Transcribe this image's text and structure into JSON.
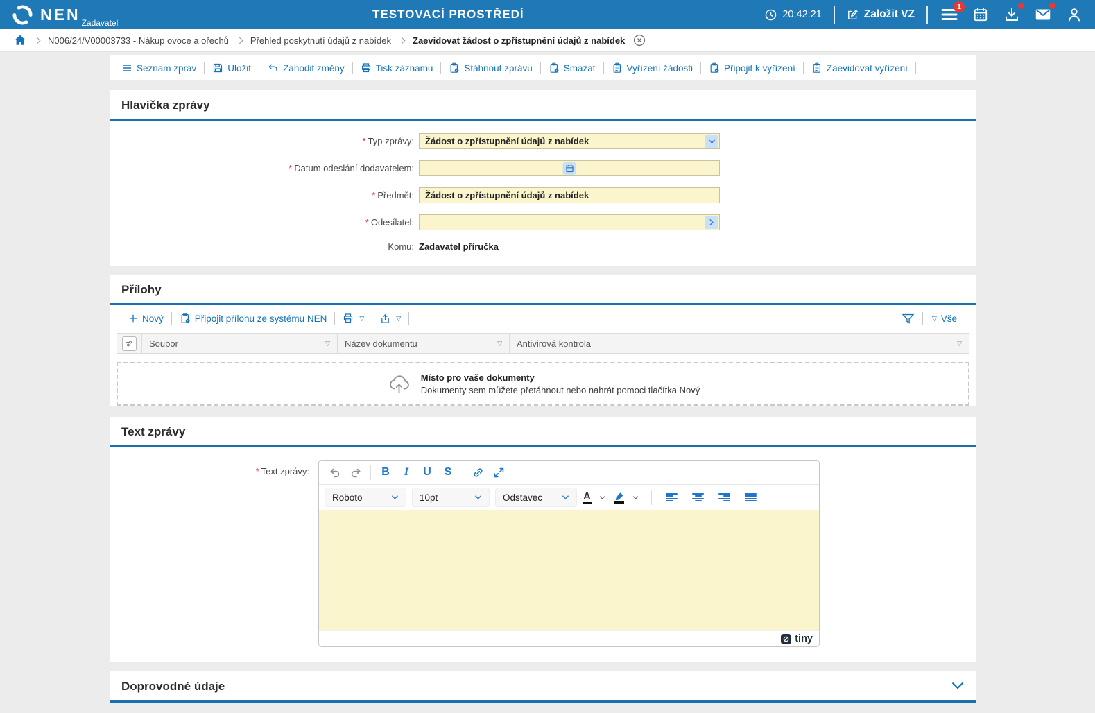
{
  "ui": {
    "required_marker": "*"
  },
  "colors": {
    "header_blue": "#1E79B6",
    "accent_blue": "#1474B8",
    "field_yellow": "#FBF5CD",
    "badge_red": "#E53935",
    "section_line_blue": "#1B6FAE",
    "editor_icon_blue": "#2276C9"
  },
  "header": {
    "logo": "NEN",
    "logo_sub": "Zadavatel",
    "env_title": "TESTOVACÍ PROSTŘEDÍ",
    "time": "20:42:21",
    "create_vz_label": "Založit VZ",
    "menu_badge": "1"
  },
  "breadcrumb": {
    "items": [
      "N006/24/V00003733 - Nákup ovoce a ořechů",
      "Přehled poskytnutí údajů z nabídek",
      "Zaevidovat žádost o zpřístupnění údajů z nabídek"
    ]
  },
  "toolbar": {
    "items": [
      {
        "label": "Seznam zpráv",
        "icon": "menu-icon"
      },
      {
        "label": "Uložit",
        "icon": "save-icon"
      },
      {
        "label": "Zahodit změny",
        "icon": "discard-icon"
      },
      {
        "label": "Tisk záznamu",
        "icon": "print-icon"
      },
      {
        "label": "Stáhnout zprávu",
        "icon": "doc-gear-icon"
      },
      {
        "label": "Smazat",
        "icon": "doc-gear-icon"
      },
      {
        "label": "Vyřízení žádosti",
        "icon": "clipboard-icon"
      },
      {
        "label": "Připojit k vyřízení",
        "icon": "doc-gear-icon"
      },
      {
        "label": "Zaevidovat vyřízení",
        "icon": "clipboard-icon"
      }
    ]
  },
  "message_header": {
    "title": "Hlavička zprávy",
    "fields": {
      "typ_zpravy": {
        "label": "Typ zprávy:",
        "value": "Žádost o zpřístupnění údajů z nabídek",
        "required": true
      },
      "datum": {
        "label": "Datum odeslání dodavatelem:",
        "value": "",
        "required": true
      },
      "predmet": {
        "label": "Předmět:",
        "value": "Žádost o zpřístupnění údajů z nabídek",
        "required": true
      },
      "odesilatel": {
        "label": "Odesílatel:",
        "value": "",
        "required": true
      },
      "komu": {
        "label": "Komu:",
        "value": "Zadavatel příručka",
        "required": false
      }
    }
  },
  "attachments": {
    "title": "Přílohy",
    "toolbar": {
      "new_label": "Nový",
      "attach_label": "Připojit přílohu ze systému NEN",
      "all_label": "Vše"
    },
    "table": {
      "columns": [
        "Soubor",
        "Název dokumentu",
        "Antivirová kontrola"
      ],
      "rows": []
    },
    "dropzone": {
      "title": "Místo pro vaše dokumenty",
      "subtitle": "Dokumenty sem můžete přetáhnout nebo nahrát pomoci tlačítka Nový"
    }
  },
  "message_text": {
    "title": "Text zprávy",
    "label": "Text zprávy:",
    "editor": {
      "font_name": "Roboto",
      "font_size": "10pt",
      "block_format": "Odstavec",
      "bold": "B",
      "italic": "I",
      "underline": "U",
      "strikethrough": "S",
      "color_letter": "A",
      "content": "",
      "brand": "tiny"
    }
  },
  "additional": {
    "title": "Doprovodné údaje"
  },
  "icons": {
    "nen-swirl-icon": "white swirl ring",
    "clock-icon": "clock outline",
    "edit-icon": "pencil-square",
    "menu-icon": "hamburger bars",
    "calendar-icon": "calendar grid",
    "download-icon": "tray with down arrow",
    "mail-icon": "envelope",
    "user-icon": "person outline",
    "home-icon": "house",
    "close-circle-icon": "x in circle",
    "save-icon": "floppy disk",
    "discard-icon": "undo arrow",
    "print-icon": "printer",
    "doc-gear-icon": "document with gear",
    "clipboard-icon": "clipboard with lines",
    "plus-icon": "plus",
    "share-icon": "up arrow from tray",
    "filter-icon": "funnel",
    "column-filter-icon": "▽",
    "settings-columns-icon": "sliders",
    "cloud-upload-icon": "cloud with up arrow",
    "undo-icon": "curved arrow left",
    "redo-icon": "curved arrow right",
    "link-icon": "chain link",
    "fullscreen-icon": "expand arrows",
    "align-left-icon": "bars left",
    "align-center-icon": "bars centered",
    "align-right-icon": "bars right",
    "align-justify-icon": "bars justified",
    "highlight-icon": "marker pen",
    "chevron-down-icon": "v chevron",
    "chevron-right-icon": "> chevron"
  }
}
